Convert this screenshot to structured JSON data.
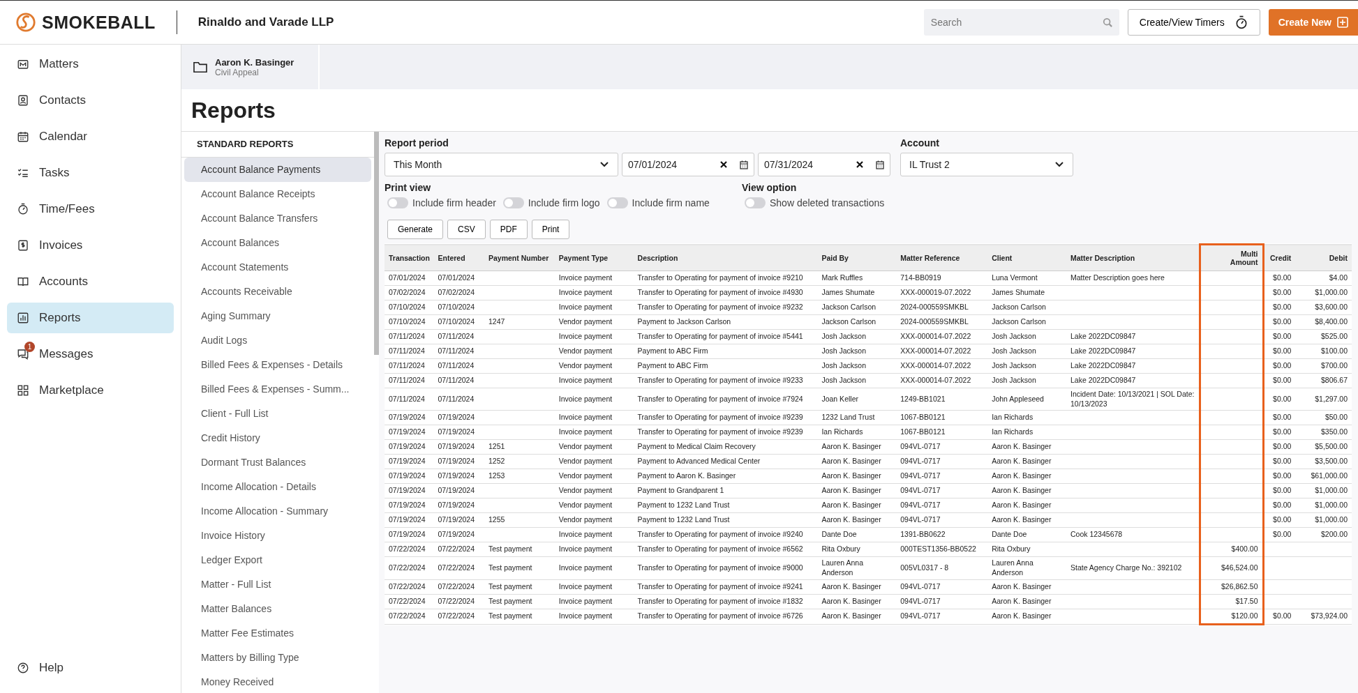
{
  "brand": {
    "name": "SMOKEBALL",
    "firm": "Rinaldo and Varade LLP"
  },
  "header": {
    "search_placeholder": "Search",
    "timers_button": "Create/View Timers",
    "create_button": "Create New"
  },
  "nav": {
    "items": [
      {
        "label": "Matters",
        "selected": false
      },
      {
        "label": "Contacts",
        "selected": false
      },
      {
        "label": "Calendar",
        "selected": false
      },
      {
        "label": "Tasks",
        "selected": false
      },
      {
        "label": "Time/Fees",
        "selected": false
      },
      {
        "label": "Invoices",
        "selected": false
      },
      {
        "label": "Accounts",
        "selected": false
      },
      {
        "label": "Reports",
        "selected": true
      },
      {
        "label": "Messages",
        "selected": false,
        "badge": "1"
      },
      {
        "label": "Marketplace",
        "selected": false
      }
    ],
    "help": "Help"
  },
  "matter_tab": {
    "name": "Aaron K. Basinger",
    "type": "Civil Appeal"
  },
  "page_title": "Reports",
  "report_list": {
    "heading": "STANDARD REPORTS",
    "items": [
      {
        "label": "Account Balance Payments",
        "selected": true
      },
      {
        "label": "Account Balance Receipts",
        "selected": false
      },
      {
        "label": "Account Balance Transfers",
        "selected": false
      },
      {
        "label": "Account Balances",
        "selected": false
      },
      {
        "label": "Account Statements",
        "selected": false
      },
      {
        "label": "Accounts Receivable",
        "selected": false
      },
      {
        "label": "Aging Summary",
        "selected": false
      },
      {
        "label": "Audit Logs",
        "selected": false
      },
      {
        "label": "Billed Fees & Expenses - Details",
        "selected": false
      },
      {
        "label": "Billed Fees & Expenses - Summ...",
        "selected": false
      },
      {
        "label": "Client - Full List",
        "selected": false
      },
      {
        "label": "Credit History",
        "selected": false
      },
      {
        "label": "Dormant Trust Balances",
        "selected": false
      },
      {
        "label": "Income Allocation - Details",
        "selected": false
      },
      {
        "label": "Income Allocation - Summary",
        "selected": false
      },
      {
        "label": "Invoice History",
        "selected": false
      },
      {
        "label": "Ledger Export",
        "selected": false
      },
      {
        "label": "Matter - Full List",
        "selected": false
      },
      {
        "label": "Matter Balances",
        "selected": false
      },
      {
        "label": "Matter Fee Estimates",
        "selected": false
      },
      {
        "label": "Matters by Billing Type",
        "selected": false
      },
      {
        "label": "Money Received",
        "selected": false
      }
    ]
  },
  "filters": {
    "report_period_label": "Report period",
    "report_period": "This Month",
    "start_date": "07/01/2024",
    "end_date": "07/31/2024",
    "account_label": "Account",
    "account": "IL Trust 2",
    "print_view_label": "Print view",
    "print_options": [
      {
        "label": "Include firm header",
        "on": false
      },
      {
        "label": "Include firm logo",
        "on": false
      },
      {
        "label": "Include firm name",
        "on": false
      }
    ],
    "view_option_label": "View option",
    "view_options": [
      {
        "label": "Show deleted transactions",
        "on": false
      }
    ]
  },
  "actions": [
    "Generate",
    "CSV",
    "PDF",
    "Print"
  ],
  "table": {
    "columns": [
      {
        "label": "Transaction",
        "highlighted": false
      },
      {
        "label": "Entered",
        "highlighted": false
      },
      {
        "label": "Payment Number",
        "highlighted": false
      },
      {
        "label": "Payment Type",
        "highlighted": false
      },
      {
        "label": "Description",
        "highlighted": false
      },
      {
        "label": "Paid By",
        "highlighted": false
      },
      {
        "label": "Matter Reference",
        "highlighted": false
      },
      {
        "label": "Client",
        "highlighted": false
      },
      {
        "label": "Matter Description",
        "highlighted": false
      },
      {
        "label": "Multi Amount",
        "highlighted": true
      },
      {
        "label": "Credit",
        "highlighted": false
      },
      {
        "label": "Debit",
        "highlighted": false
      }
    ],
    "rows": [
      {
        "transaction": "07/01/2024",
        "entered": "07/01/2024",
        "payment_type": "Invoice payment",
        "description": "Transfer to Operating for payment of invoice #9210",
        "paid_by": "Mark Ruffles",
        "matter_reference": "714-BB0919",
        "client": "Luna Vermont",
        "matter_description": "Matter Description goes here",
        "credit": "$0.00",
        "debit": "$4.00"
      },
      {
        "transaction": "07/02/2024",
        "entered": "07/02/2024",
        "payment_type": "Invoice payment",
        "description": "Transfer to Operating for payment of invoice #4930",
        "paid_by": "James Shumate",
        "matter_reference": "XXX-000019-07.2022",
        "client": "James Shumate",
        "credit": "$0.00",
        "debit": "$1,000.00"
      },
      {
        "transaction": "07/10/2024",
        "entered": "07/10/2024",
        "payment_type": "Invoice payment",
        "description": "Transfer to Operating for payment of invoice #9232",
        "paid_by": "Jackson Carlson",
        "matter_reference": "2024-000559SMKBL",
        "client": "Jackson Carlson",
        "credit": "$0.00",
        "debit": "$3,600.00"
      },
      {
        "transaction": "07/10/2024",
        "entered": "07/10/2024",
        "payment_number": "1247",
        "payment_type": "Vendor payment",
        "description": "Payment to Jackson Carlson",
        "paid_by": "Jackson Carlson",
        "matter_reference": "2024-000559SMKBL",
        "client": "Jackson Carlson",
        "credit": "$0.00",
        "debit": "$8,400.00"
      },
      {
        "transaction": "07/11/2024",
        "entered": "07/11/2024",
        "payment_type": "Invoice payment",
        "description": "Transfer to Operating for payment of invoice #5441",
        "paid_by": "Josh Jackson",
        "matter_reference": "XXX-000014-07.2022",
        "client": "Josh Jackson",
        "matter_description": "Lake 2022DC09847",
        "credit": "$0.00",
        "debit": "$525.00"
      },
      {
        "transaction": "07/11/2024",
        "entered": "07/11/2024",
        "payment_type": "Vendor payment",
        "description": "Payment to ABC Firm",
        "paid_by": "Josh Jackson",
        "matter_reference": "XXX-000014-07.2022",
        "client": "Josh Jackson",
        "matter_description": "Lake 2022DC09847",
        "credit": "$0.00",
        "debit": "$100.00"
      },
      {
        "transaction": "07/11/2024",
        "entered": "07/11/2024",
        "payment_type": "Vendor payment",
        "description": "Payment to ABC Firm",
        "paid_by": "Josh Jackson",
        "matter_reference": "XXX-000014-07.2022",
        "client": "Josh Jackson",
        "matter_description": "Lake 2022DC09847",
        "credit": "$0.00",
        "debit": "$700.00"
      },
      {
        "transaction": "07/11/2024",
        "entered": "07/11/2024",
        "payment_type": "Invoice payment",
        "description": "Transfer to Operating for payment of invoice #9233",
        "paid_by": "Josh Jackson",
        "matter_reference": "XXX-000014-07.2022",
        "client": "Josh Jackson",
        "matter_description": "Lake 2022DC09847",
        "credit": "$0.00",
        "debit": "$806.67"
      },
      {
        "transaction": "07/11/2024",
        "entered": "07/11/2024",
        "payment_type": "Invoice payment",
        "description": "Transfer to Operating for payment of invoice #7924",
        "paid_by": "Joan Keller",
        "matter_reference": "1249-BB1021",
        "client": "John Appleseed",
        "matter_description": "Incident Date: 10/13/2021 | SOL Date: 10/13/2023",
        "credit": "$0.00",
        "debit": "$1,297.00"
      },
      {
        "transaction": "07/19/2024",
        "entered": "07/19/2024",
        "payment_type": "Invoice payment",
        "description": "Transfer to Operating for payment of invoice #9239",
        "paid_by": "1232 Land Trust",
        "matter_reference": "1067-BB0121",
        "client": "Ian Richards",
        "credit": "$0.00",
        "debit": "$50.00"
      },
      {
        "transaction": "07/19/2024",
        "entered": "07/19/2024",
        "payment_type": "Invoice payment",
        "description": "Transfer to Operating for payment of invoice #9239",
        "paid_by": "Ian Richards",
        "matter_reference": "1067-BB0121",
        "client": "Ian Richards",
        "credit": "$0.00",
        "debit": "$350.00"
      },
      {
        "transaction": "07/19/2024",
        "entered": "07/19/2024",
        "payment_number": "1251",
        "payment_type": "Vendor payment",
        "description": "Payment to Medical Claim Recovery",
        "paid_by": "Aaron K. Basinger",
        "matter_reference": "094VL-0717",
        "client": "Aaron K. Basinger",
        "credit": "$0.00",
        "debit": "$5,500.00"
      },
      {
        "transaction": "07/19/2024",
        "entered": "07/19/2024",
        "payment_number": "1252",
        "payment_type": "Vendor payment",
        "description": "Payment to Advanced Medical Center",
        "paid_by": "Aaron K. Basinger",
        "matter_reference": "094VL-0717",
        "client": "Aaron K. Basinger",
        "credit": "$0.00",
        "debit": "$3,500.00"
      },
      {
        "transaction": "07/19/2024",
        "entered": "07/19/2024",
        "payment_number": "1253",
        "payment_type": "Vendor payment",
        "description": "Payment to Aaron K. Basinger",
        "paid_by": "Aaron K. Basinger",
        "matter_reference": "094VL-0717",
        "client": "Aaron K. Basinger",
        "credit": "$0.00",
        "debit": "$61,000.00"
      },
      {
        "transaction": "07/19/2024",
        "entered": "07/19/2024",
        "payment_type": "Vendor payment",
        "description": "Payment to Grandparent 1",
        "paid_by": "Aaron K. Basinger",
        "matter_reference": "094VL-0717",
        "client": "Aaron K. Basinger",
        "credit": "$0.00",
        "debit": "$1,000.00"
      },
      {
        "transaction": "07/19/2024",
        "entered": "07/19/2024",
        "payment_type": "Vendor payment",
        "description": "Payment to 1232 Land Trust",
        "paid_by": "Aaron K. Basinger",
        "matter_reference": "094VL-0717",
        "client": "Aaron K. Basinger",
        "credit": "$0.00",
        "debit": "$1,000.00"
      },
      {
        "transaction": "07/19/2024",
        "entered": "07/19/2024",
        "payment_number": "1255",
        "payment_type": "Vendor payment",
        "description": "Payment to 1232 Land Trust",
        "paid_by": "Aaron K. Basinger",
        "matter_reference": "094VL-0717",
        "client": "Aaron K. Basinger",
        "credit": "$0.00",
        "debit": "$1,000.00"
      },
      {
        "transaction": "07/19/2024",
        "entered": "07/19/2024",
        "payment_type": "Invoice payment",
        "description": "Transfer to Operating for payment of invoice #9240",
        "paid_by": "Dante Doe",
        "matter_reference": "1391-BB0622",
        "client": "Dante Doe",
        "matter_description": "Cook 12345678",
        "credit": "$0.00",
        "debit": "$200.00"
      },
      {
        "transaction": "07/22/2024",
        "entered": "07/22/2024",
        "payment_number": "Test payment",
        "payment_type": "Invoice payment",
        "description": "Transfer to Operating for payment of invoice #6562",
        "paid_by": "Rita Oxbury",
        "matter_reference": "000TEST1356-BB0522",
        "client": "Rita Oxbury",
        "multi_amount": "$400.00"
      },
      {
        "transaction": "07/22/2024",
        "entered": "07/22/2024",
        "payment_number": "Test payment",
        "payment_type": "Invoice payment",
        "description": "Transfer to Operating for payment of invoice #9000",
        "paid_by": "Lauren Anna Anderson",
        "matter_reference": "005VL0317 - 8",
        "client": "Lauren Anna Anderson",
        "matter_description": "State Agency Charge No.: 392102",
        "multi_amount": "$46,524.00"
      },
      {
        "transaction": "07/22/2024",
        "entered": "07/22/2024",
        "payment_number": "Test payment",
        "payment_type": "Invoice payment",
        "description": "Transfer to Operating for payment of invoice #9241",
        "paid_by": "Aaron K. Basinger",
        "matter_reference": "094VL-0717",
        "client": "Aaron K. Basinger",
        "multi_amount": "$26,862.50"
      },
      {
        "transaction": "07/22/2024",
        "entered": "07/22/2024",
        "payment_number": "Test payment",
        "payment_type": "Invoice payment",
        "description": "Transfer to Operating for payment of invoice #1832",
        "paid_by": "Aaron K. Basinger",
        "matter_reference": "094VL-0717",
        "client": "Aaron K. Basinger",
        "multi_amount": "$17.50"
      },
      {
        "transaction": "07/22/2024",
        "entered": "07/22/2024",
        "payment_number": "Test payment",
        "payment_type": "Invoice payment",
        "description": "Transfer to Operating for payment of invoice #6726",
        "paid_by": "Aaron K. Basinger",
        "matter_reference": "094VL-0717",
        "client": "Aaron K. Basinger",
        "multi_amount": "$120.00",
        "credit": "$0.00",
        "debit": "$73,924.00"
      }
    ]
  }
}
